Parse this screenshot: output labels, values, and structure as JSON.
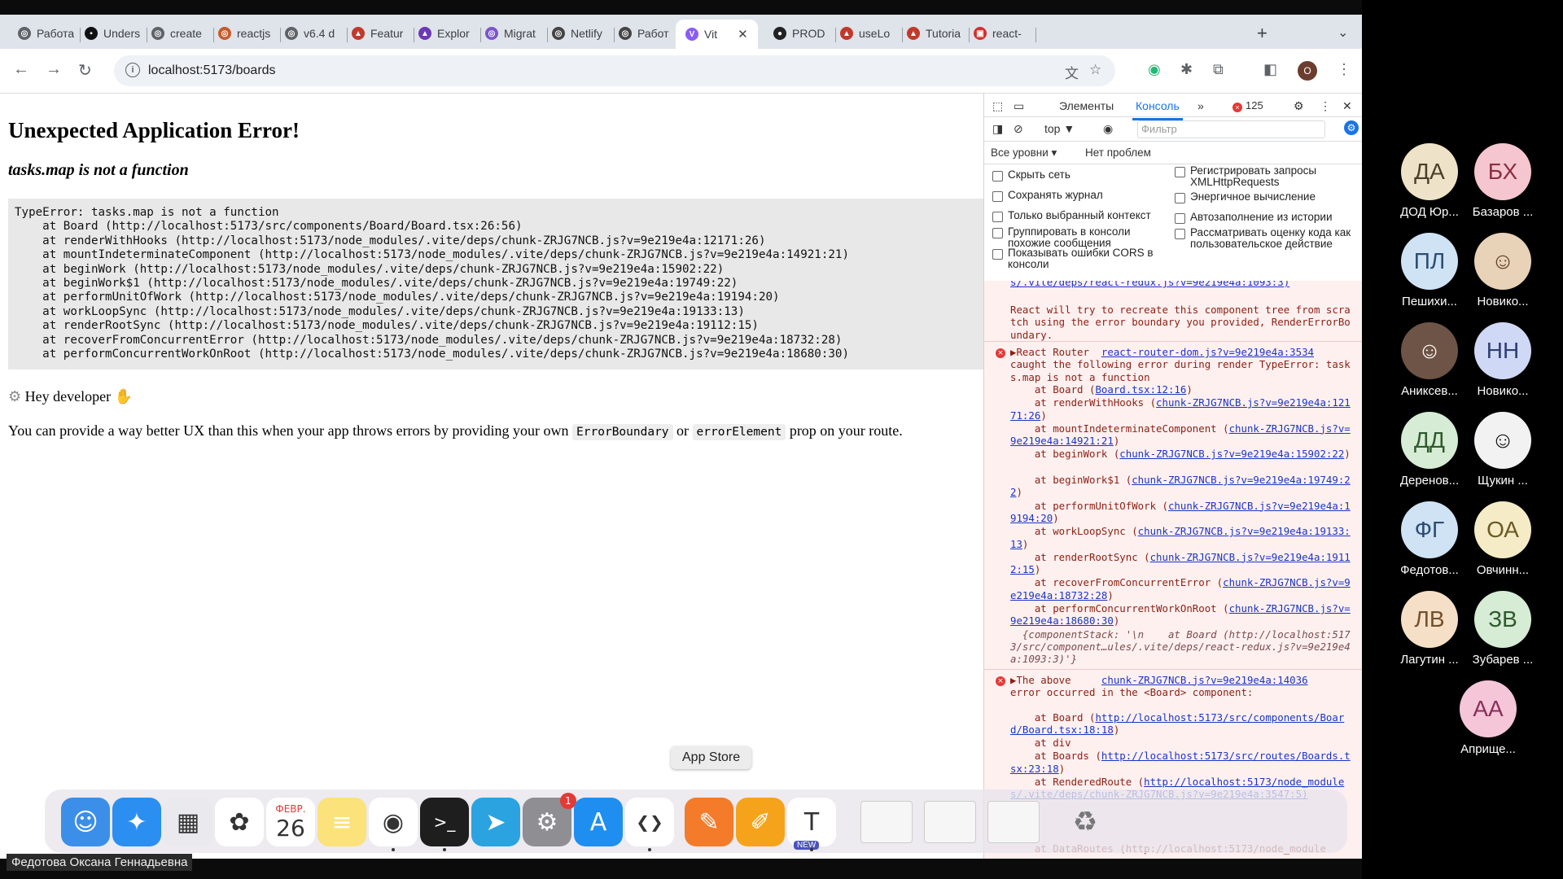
{
  "browser": {
    "tabs": [
      {
        "label": "Работа",
        "color": "#5f6368",
        "glyph": "◎"
      },
      {
        "label": "Unders",
        "color": "#111111",
        "glyph": "▪"
      },
      {
        "label": "create",
        "color": "#5f6368",
        "glyph": "◎"
      },
      {
        "label": "reactjs",
        "color": "#c45b2c",
        "glyph": "◎"
      },
      {
        "label": "v6.4 d",
        "color": "#5f6368",
        "glyph": "◎"
      },
      {
        "label": "Featur",
        "color": "#c0392b",
        "glyph": "▲"
      },
      {
        "label": "Explor",
        "color": "#6a3ab2",
        "glyph": "▲"
      },
      {
        "label": "Migrat",
        "color": "#7b56c8",
        "glyph": "◎"
      },
      {
        "label": "Netlify",
        "color": "#444444",
        "glyph": "◎"
      },
      {
        "label": "Работ",
        "color": "#444444",
        "glyph": "◎"
      },
      {
        "label": "Vit",
        "color": "#8a5cf6",
        "glyph": "V"
      },
      {
        "label": "PROD",
        "color": "#222222",
        "glyph": "●"
      },
      {
        "label": "useLo",
        "color": "#c0392b",
        "glyph": "▲"
      },
      {
        "label": "Tutoria",
        "color": "#c0392b",
        "glyph": "▲"
      },
      {
        "label": "react-",
        "color": "#d32f2f",
        "glyph": "▣"
      }
    ],
    "url": "localhost:5173/boards",
    "profile_initial": "O"
  },
  "page": {
    "title": "Unexpected Application Error!",
    "subtitle": "tasks.map is not a function",
    "stack": [
      "TypeError: tasks.map is not a function",
      "    at Board (http://localhost:5173/src/components/Board/Board.tsx:26:56)",
      "    at renderWithHooks (http://localhost:5173/node_modules/.vite/deps/chunk-ZRJG7NCB.js?v=9e219e4a:12171:26)",
      "    at mountIndeterminateComponent (http://localhost:5173/node_modules/.vite/deps/chunk-ZRJG7NCB.js?v=9e219e4a:14921:21)",
      "    at beginWork (http://localhost:5173/node_modules/.vite/deps/chunk-ZRJG7NCB.js?v=9e219e4a:15902:22)",
      "    at beginWork$1 (http://localhost:5173/node_modules/.vite/deps/chunk-ZRJG7NCB.js?v=9e219e4a:19749:22)",
      "    at performUnitOfWork (http://localhost:5173/node_modules/.vite/deps/chunk-ZRJG7NCB.js?v=9e219e4a:19194:20)",
      "    at workLoopSync (http://localhost:5173/node_modules/.vite/deps/chunk-ZRJG7NCB.js?v=9e219e4a:19133:13)",
      "    at renderRootSync (http://localhost:5173/node_modules/.vite/deps/chunk-ZRJG7NCB.js?v=9e219e4a:19112:15)",
      "    at recoverFromConcurrentError (http://localhost:5173/node_modules/.vite/deps/chunk-ZRJG7NCB.js?v=9e219e4a:18732:28)",
      "    at performConcurrentWorkOnRoot (http://localhost:5173/node_modules/.vite/deps/chunk-ZRJG7NCB.js?v=9e219e4a:18680:30)"
    ],
    "hey": "Hey developer",
    "note_before": "You can provide a way better UX than this when your app throws errors by providing your own",
    "note_code1": "ErrorBoundary",
    "note_or": "or",
    "note_code2": "errorElement",
    "note_after": "prop on your route."
  },
  "devtools": {
    "tab_elements": "Элементы",
    "tab_console": "Консоль",
    "error_count": "125",
    "context": "top ▼",
    "filter_placeholder": "Фильтр",
    "levels": "Все уровни ▾",
    "no_issues": "Нет проблем",
    "options": [
      "Скрыть сеть",
      "Сохранять журнал",
      "Только выбранный контекст",
      "Группировать в консоли похожие сообщения",
      "Показывать ошибки CORS в консоли",
      "Регистрировать запросы XMLHttpRequests",
      "Энергичное вычисление",
      "Автозаполнение из истории",
      "Рассматривать оценку кода как пользовательское действие"
    ],
    "console": {
      "top_link": "s/.vite/deps/react-redux.js?v=9e219e4a:1093:3)",
      "recreate": "React will try to recreate this component tree from scratch using the error boundary you provided, RenderErrorBoundary.",
      "msg1_head": "▶React Router",
      "msg1_link": "react-router-dom.js?v=9e219e4a:3534",
      "msg1_body": "caught the following error during render TypeError: tasks.map is not a function",
      "msg1_lines": [
        {
          "pre": "    at Board (",
          "link": "Board.tsx:12:16",
          "post": ")"
        },
        {
          "pre": "    at renderWithHooks (",
          "link": "chunk-ZRJG7NCB.js?v=9e219e4a:12171:26",
          "post": ")"
        },
        {
          "pre": "    at mountIndeterminateComponent (",
          "link": "chunk-ZRJG7NCB.js?v=9e219e4a:14921:21",
          "post": ")"
        },
        {
          "pre": "    at beginWork (",
          "link": "chunk-ZRJG7NCB.js?v=9e219e4a:15902:22",
          "post": ")"
        },
        {
          "pre": "    at beginWork$1 (",
          "link": "chunk-ZRJG7NCB.js?v=9e219e4a:19749:22",
          "post": ")"
        },
        {
          "pre": "    at performUnitOfWork (",
          "link": "chunk-ZRJG7NCB.js?v=9e219e4a:19194:20",
          "post": ")"
        },
        {
          "pre": "    at workLoopSync (",
          "link": "chunk-ZRJG7NCB.js?v=9e219e4a:19133:13",
          "post": ")"
        },
        {
          "pre": "    at renderRootSync (",
          "link": "chunk-ZRJG7NCB.js?v=9e219e4a:19112:15",
          "post": ")"
        },
        {
          "pre": "    at recoverFromConcurrentError (",
          "link": "chunk-ZRJG7NCB.js?v=9e219e4a:18732:28",
          "post": ")"
        },
        {
          "pre": "    at performConcurrentWorkOnRoot (",
          "link": "chunk-ZRJG7NCB.js?v=9e219e4a:18680:30",
          "post": ")"
        }
      ],
      "component_stack": "  {componentStack: '\\n    at Board (http://localhost:5173/src/component…ules/.vite/deps/react-redux.js?v=9e219e4a:1093:3)'}",
      "msg2_head": "▶The above",
      "msg2_link": "chunk-ZRJG7NCB.js?v=9e219e4a:14036",
      "msg2_body": "error occurred in the <Board> component:",
      "msg2_lines": [
        {
          "pre": "    at Board (",
          "link": "http://localhost:5173/src/components/Board/Board.tsx:18:18",
          "post": ")"
        },
        {
          "pre": "    at div",
          "link": "",
          "post": ""
        },
        {
          "pre": "    at Boards (",
          "link": "http://localhost:5173/src/routes/Boards.tsx:23:18",
          "post": ")"
        },
        {
          "pre": "    at RenderedRoute (",
          "link": "http://localhost:5173/node_modules/.vite/deps/chunk-ZRJG7NCB.js?v=9e219e4a:3547:5)",
          "post": ""
        }
      ],
      "bottom_line": "    at DataRoutes (http://localhost:5173/node_module"
    }
  },
  "call": {
    "participants": [
      {
        "initials": "ДА",
        "name": "ДОД Юр...",
        "bg": "#eee3c8",
        "fg": "#4a3f2a"
      },
      {
        "initials": "БХ",
        "name": "Базаров ...",
        "bg": "#f5c6cf",
        "fg": "#8a2f43"
      },
      {
        "initials": "ПЛ",
        "name": "Пешихи...",
        "bg": "#cfe3f5",
        "fg": "#2d4d72"
      },
      {
        "initials": "",
        "name": "Новико...",
        "bg": "#e8d2b8",
        "fg": "#5a3d22"
      },
      {
        "initials": "",
        "name": "Аниксев...",
        "bg": "#6e5446",
        "fg": "#ffffff"
      },
      {
        "initials": "НН",
        "name": "Новико...",
        "bg": "#cfd9f5",
        "fg": "#2f3e73"
      },
      {
        "initials": "ДД",
        "name": "Деренов...",
        "bg": "#d6ecd5",
        "fg": "#2f5a2d"
      },
      {
        "initials": "",
        "name": "Щукин ...",
        "bg": "#f2f2f2",
        "fg": "#111111"
      },
      {
        "initials": "ФГ",
        "name": "Федотов...",
        "bg": "#cfe3f5",
        "fg": "#2d4d72"
      },
      {
        "initials": "ОА",
        "name": "Овчинн...",
        "bg": "#f5ebc6",
        "fg": "#6a5a25"
      },
      {
        "initials": "ЛВ",
        "name": "Лагутин ...",
        "bg": "#f5dfc6",
        "fg": "#73502d"
      },
      {
        "initials": "ЗВ",
        "name": "Зубарев ...",
        "bg": "#d6ecd5",
        "fg": "#2f5a2d"
      },
      {
        "initials": "АА",
        "name": "Априще...",
        "bg": "#f5c6d8",
        "fg": "#8a2f5a"
      }
    ]
  },
  "dock": {
    "tooltip": "App Store",
    "calendar_month": "ФЕВР.",
    "calendar_day": "26",
    "settings_badge": "1",
    "teams_badge": "NEW",
    "apps": [
      {
        "name": "finder",
        "bg": "#3b8fe8",
        "glyph": "☺"
      },
      {
        "name": "safari",
        "bg": "#2a8ff0",
        "glyph": "✦"
      },
      {
        "name": "launchpad",
        "bg": "#e9e9ee",
        "glyph": "▦"
      },
      {
        "name": "photos",
        "bg": "#ffffff",
        "glyph": "✿"
      },
      {
        "name": "calendar",
        "bg": "#ffffff",
        "glyph": ""
      },
      {
        "name": "notes",
        "bg": "#fbe27a",
        "glyph": "≡"
      },
      {
        "name": "chrome",
        "bg": "#ffffff",
        "glyph": "◉"
      },
      {
        "name": "terminal",
        "bg": "#1e1e1e",
        "glyph": ">_"
      },
      {
        "name": "telegram",
        "bg": "#2aa3e0",
        "glyph": "➤"
      },
      {
        "name": "system-settings",
        "bg": "#8e8e93",
        "glyph": "⚙"
      },
      {
        "name": "app-store",
        "bg": "#1f8ef1",
        "glyph": "A"
      },
      {
        "name": "vscode",
        "bg": "#ffffff",
        "glyph": "❮❯"
      },
      {
        "name": "pages",
        "bg": "#f47b2a",
        "glyph": "✎"
      },
      {
        "name": "pencil",
        "bg": "#f6a31c",
        "glyph": "✐"
      },
      {
        "name": "teams",
        "bg": "#ffffff",
        "glyph": "T"
      }
    ]
  },
  "screen_user": "Федотова Оксана Геннадьевна"
}
